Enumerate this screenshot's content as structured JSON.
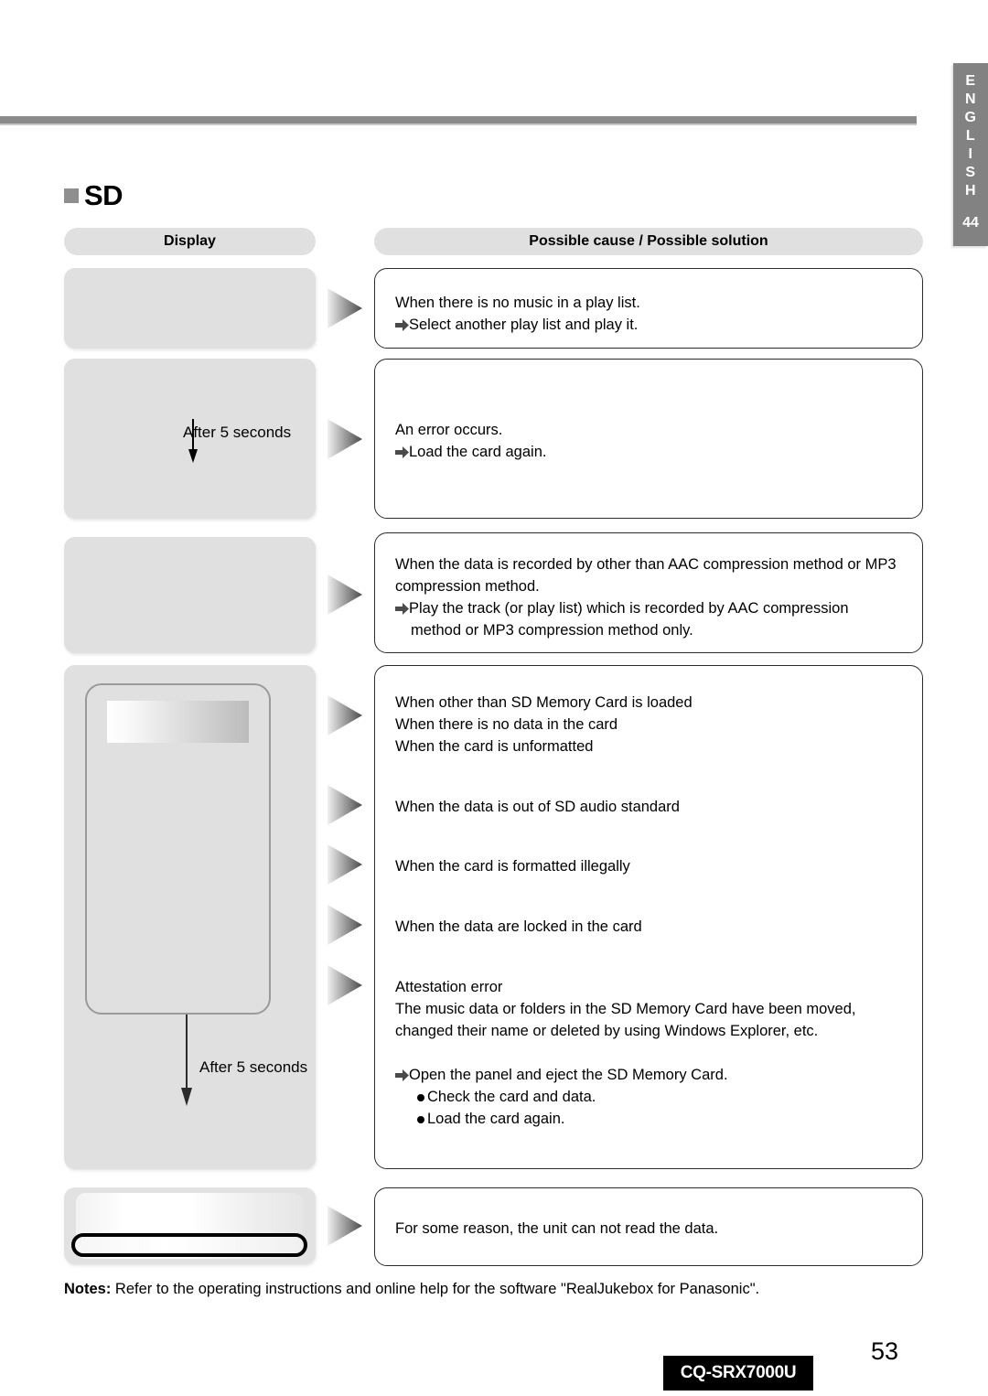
{
  "sidebar": {
    "language_letters": [
      "E",
      "N",
      "G",
      "L",
      "I",
      "S",
      "H"
    ],
    "ref_number": "44"
  },
  "section": {
    "title": "SD"
  },
  "columns": {
    "display_label": "Display",
    "cause_label": "Possible cause / Possible solution"
  },
  "rows": [
    {
      "display": {
        "type": "blank-gray"
      },
      "cause_lines": [
        {
          "text": "When there is no music in a play list.",
          "arrow": false,
          "indent": 0
        },
        {
          "text": "Select another play list and play it.",
          "arrow": true,
          "indent": 0
        }
      ]
    },
    {
      "display": {
        "type": "timer",
        "timer_label": "After 5 seconds"
      },
      "cause_lines": [
        {
          "text": "An error occurs.",
          "arrow": false,
          "indent": 0
        },
        {
          "text": "Load the card again.",
          "arrow": true,
          "indent": 0
        }
      ]
    },
    {
      "display": {
        "type": "blank-gray"
      },
      "cause_lines": [
        {
          "text": "When the data is recorded by other than AAC compression method or MP3",
          "arrow": false,
          "indent": 0
        },
        {
          "text": "compression method.",
          "arrow": false,
          "indent": 0
        },
        {
          "text": "Play the track (or play list) which is recorded by AAC compression",
          "arrow": true,
          "indent": 0
        },
        {
          "text": "method or MP3 compression method only.",
          "arrow": false,
          "indent": 1
        }
      ]
    },
    {
      "display": {
        "type": "device",
        "timer_label": "After 5 seconds"
      },
      "cause_groups": [
        [
          {
            "text": "When other than SD Memory Card is loaded",
            "arrow": false
          },
          {
            "text": "When there is no data in the card",
            "arrow": false
          },
          {
            "text": "When the card is unformatted",
            "arrow": false
          }
        ],
        [
          {
            "text": "When the data is out of SD audio standard",
            "arrow": false
          }
        ],
        [
          {
            "text": "When the card is formatted illegally",
            "arrow": false
          }
        ],
        [
          {
            "text": "When the data are locked in the card",
            "arrow": false
          }
        ],
        [
          {
            "text": "Attestation error",
            "arrow": false
          },
          {
            "text": "The music data or folders in the SD Memory Card have been moved,",
            "arrow": false
          },
          {
            "text": "changed their name or deleted by using Windows Explorer, etc.",
            "arrow": false
          }
        ]
      ],
      "solution_lines": [
        {
          "text": "Open the panel and eject the SD Memory Card.",
          "marker": "arrow"
        },
        {
          "text": "Check the card and data.",
          "marker": "bullet"
        },
        {
          "text": "Load the card again.",
          "marker": "bullet"
        }
      ]
    },
    {
      "display": {
        "type": "pill"
      },
      "cause_lines": [
        {
          "text": "For some reason, the unit can not read the data.",
          "arrow": false,
          "indent": 0
        }
      ]
    }
  ],
  "notes": {
    "label": "Notes:",
    "text": " Refer to the operating instructions and online help for the software \"RealJukebox for Panasonic\"."
  },
  "footer": {
    "model": "CQ-SRX7000U",
    "page_number": "53"
  }
}
